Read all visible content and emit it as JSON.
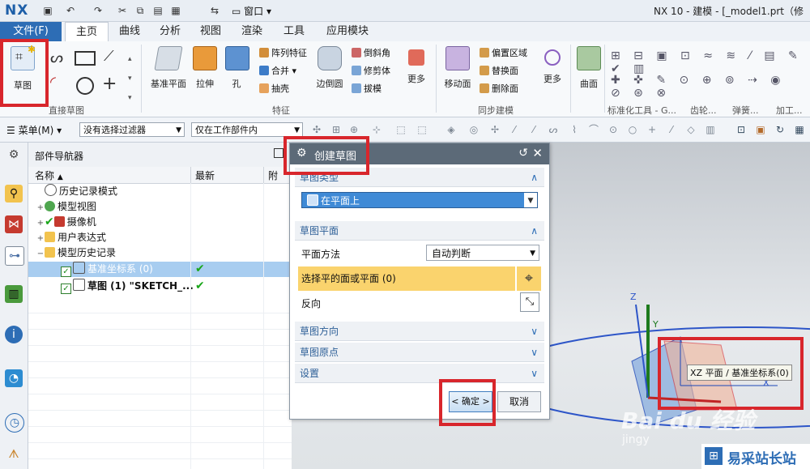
{
  "window": {
    "logo": "NX",
    "title": "NX 10 - 建模 - [_model1.prt（修"
  },
  "quick_access": {
    "window_menu": "窗口"
  },
  "tabs": [
    "文件(F)",
    "主页",
    "曲线",
    "分析",
    "视图",
    "渲染",
    "工具",
    "应用模块"
  ],
  "ribbon": {
    "sketch_label": "草图",
    "group_direct_sketch": "直接草图",
    "datum_plane": "基准平面",
    "extrude": "拉伸",
    "hole": "孔",
    "pattern_feature": "阵列特征",
    "unite": "合并",
    "shell": "抽壳",
    "edge_blend": "边倒圆",
    "chamfer": "倒斜角",
    "trim_body": "修剪体",
    "draft": "拔模",
    "more1": "更多",
    "group_feature": "特征",
    "move_face": "移动面",
    "offset_region": "偏置区域",
    "replace_face": "替换面",
    "delete_face": "删除面",
    "more2": "更多",
    "group_sync": "同步建模",
    "surface": "曲面",
    "group_std": "标准化工具 - G...",
    "group_gear": "齿轮...",
    "group_spring": "弹簧...",
    "group_machining": "加工..."
  },
  "toolbar": {
    "menu": "菜单(M)",
    "filter": "没有选择过滤器",
    "scope": "仅在工作部件内"
  },
  "navigator": {
    "title": "部件导航器",
    "col_name": "名称",
    "col_latest": "最新",
    "col_extra": "附",
    "items": [
      {
        "label": "历史记录模式"
      },
      {
        "label": "模型视图"
      },
      {
        "label": "摄像机"
      },
      {
        "label": "用户表达式"
      },
      {
        "label": "模型历史记录"
      },
      {
        "label": "基准坐标系 (0)"
      },
      {
        "label": "草图 (1) \"SKETCH_..."
      }
    ]
  },
  "dialog": {
    "title": "创建草图",
    "section_type": "草图类型",
    "type_value": "在平面上",
    "section_plane": "草图平面",
    "plane_method_label": "平面方法",
    "plane_method_value": "自动判断",
    "select_face_label": "选择平的面或平面 (0)",
    "reverse_label": "反向",
    "section_orientation": "草图方向",
    "section_origin": "草图原点",
    "section_settings": "设置",
    "ok_label": "< 确定 >",
    "cancel_label": "取消"
  },
  "graphics": {
    "axis_x": "X",
    "axis_y": "Y",
    "axis_z": "Z",
    "tooltip": "XZ 平面 / 基准坐标系(0)"
  },
  "watermark": {
    "brand": "Bai du 经验",
    "sub": "jingy",
    "site": "易采站长站"
  },
  "colors": {
    "accent": "#2d6db5",
    "highlight": "#fad36d",
    "red_box": "#d8262c"
  }
}
